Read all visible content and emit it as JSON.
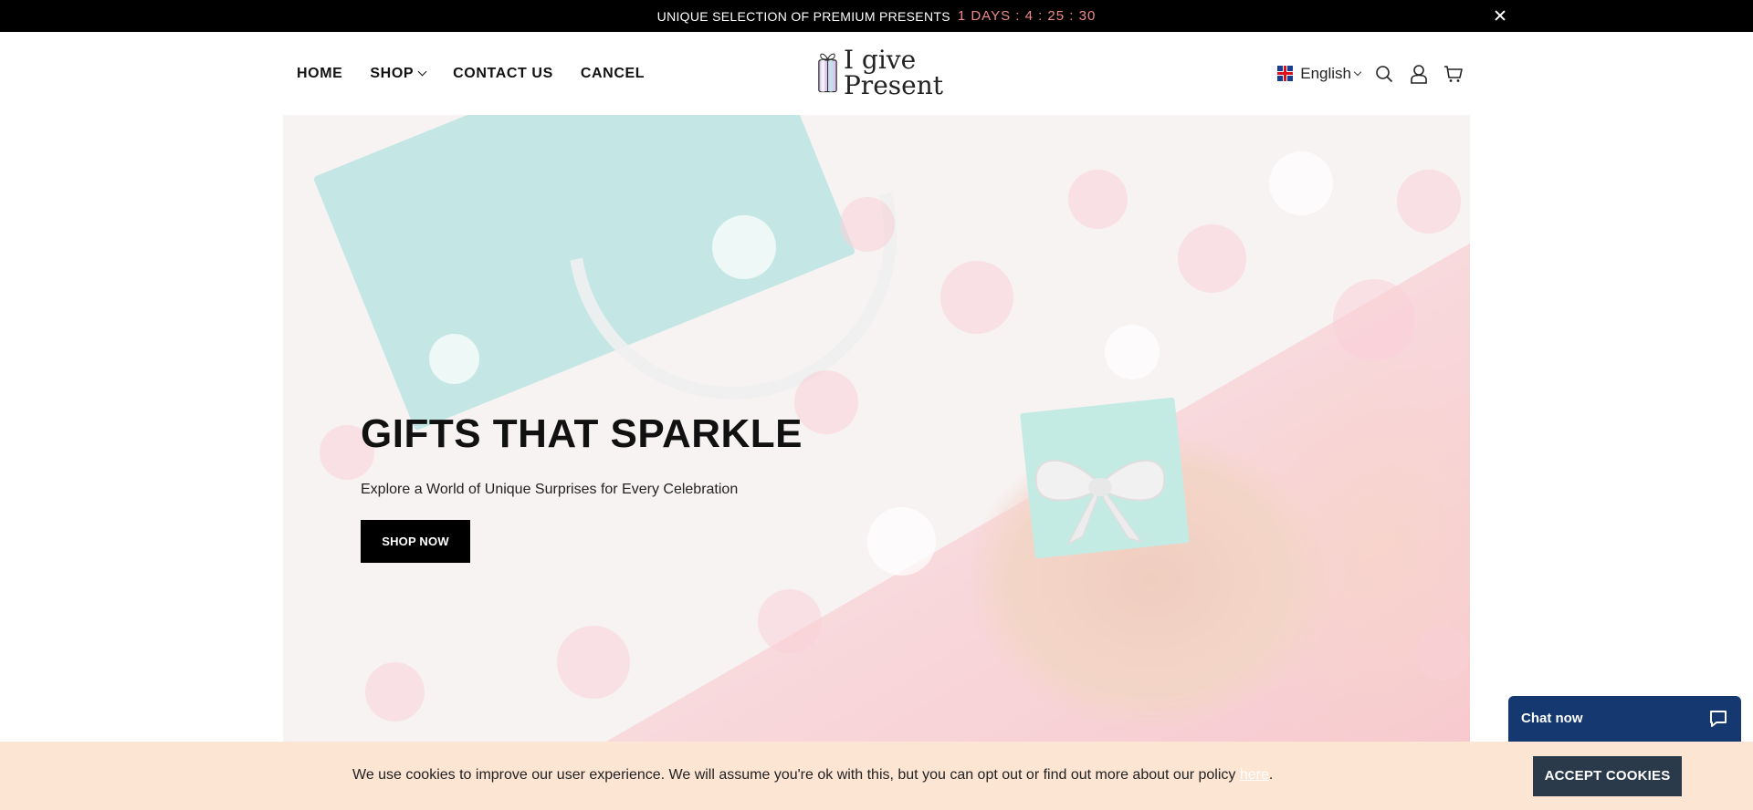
{
  "announcement": {
    "message": "UNIQUE SELECTION OF PREMIUM PRESENTS",
    "countdown": "1 DAYS : 4 : 25 : 30",
    "close_icon": "close-icon"
  },
  "nav": {
    "items": [
      {
        "label": "HOME"
      },
      {
        "label": "SHOP",
        "has_dropdown": true
      },
      {
        "label": "CONTACT US"
      },
      {
        "label": "CANCEL"
      }
    ]
  },
  "logo": {
    "line1": "I give",
    "line2": "Present"
  },
  "header_tools": {
    "language": "English",
    "flag_icon": "uk-flag-icon",
    "search_icon": "search-icon",
    "account_icon": "account-icon",
    "cart_icon": "cart-icon"
  },
  "hero": {
    "title": "GIFTS THAT SPARKLE",
    "subtitle": "Explore a World of Unique Surprises for Every Celebration",
    "button_label": "SHOP NOW"
  },
  "cookie_bar": {
    "text": "We use cookies to improve our user experience. We will assume you're ok with this, but you can opt out or find out more about our policy ",
    "link_text": "here",
    "trailing": ".",
    "accept_label": "ACCEPT COOKIES"
  },
  "chat": {
    "label": "Chat now",
    "icon": "chat-bubble-icon"
  },
  "colors": {
    "announcement_bg": "#000000",
    "countdown": "#f08a8a",
    "cookie_bg": "#fde5d4",
    "accept_button": "#2b3a4a",
    "chat_bg": "#14386f"
  }
}
